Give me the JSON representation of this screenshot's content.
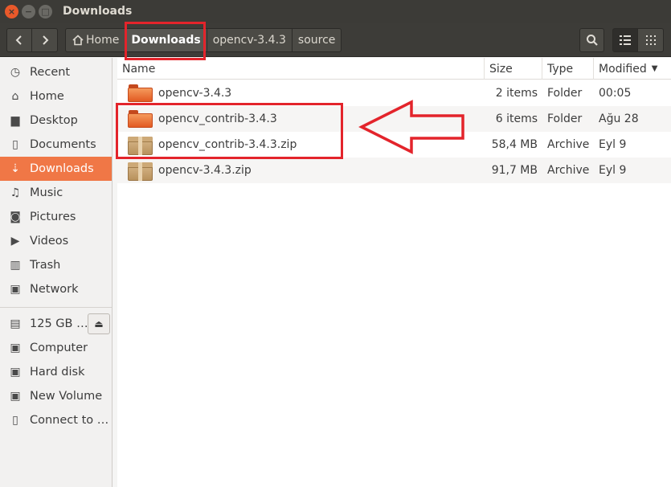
{
  "window": {
    "title": "Downloads",
    "close_glyph": "×",
    "min_glyph": "−",
    "max_glyph": "□"
  },
  "toolbar": {
    "back_glyph": "‹",
    "forward_glyph": "›",
    "breadcrumbs": [
      {
        "label": "Home",
        "icon": "home-icon"
      },
      {
        "label": "Downloads",
        "active": true
      },
      {
        "label": "opencv-3.4.3"
      },
      {
        "label": "source"
      }
    ]
  },
  "sidebar": {
    "places": [
      {
        "label": "Recent",
        "icon": "clock-icon",
        "glyph": "◷"
      },
      {
        "label": "Home",
        "icon": "home-icon",
        "glyph": "⌂"
      },
      {
        "label": "Desktop",
        "icon": "desktop-folder-icon",
        "glyph": "▆"
      },
      {
        "label": "Documents",
        "icon": "document-icon",
        "glyph": "▯"
      },
      {
        "label": "Downloads",
        "icon": "download-icon",
        "glyph": "⇣",
        "selected": true
      },
      {
        "label": "Music",
        "icon": "music-icon",
        "glyph": "♫"
      },
      {
        "label": "Pictures",
        "icon": "camera-icon",
        "glyph": "◙"
      },
      {
        "label": "Videos",
        "icon": "video-icon",
        "glyph": "▶"
      },
      {
        "label": "Trash",
        "icon": "trash-icon",
        "glyph": "▥"
      },
      {
        "label": "Network",
        "icon": "network-icon",
        "glyph": "▣"
      }
    ],
    "devices": [
      {
        "label": "125 GB …",
        "icon": "drive-icon",
        "glyph": "▤",
        "eject_glyph": "⏏"
      },
      {
        "label": "Computer",
        "icon": "computer-drive-icon",
        "glyph": "▣"
      },
      {
        "label": "Hard disk",
        "icon": "harddisk-icon",
        "glyph": "▣"
      },
      {
        "label": "New Volume",
        "icon": "volume-icon",
        "glyph": "▣"
      },
      {
        "label": "Connect to S…",
        "icon": "server-icon",
        "glyph": "▯"
      }
    ]
  },
  "columns": {
    "name": "Name",
    "size": "Size",
    "type": "Type",
    "modified": "Modified",
    "sort_glyph": "▼"
  },
  "files": [
    {
      "name": "opencv-3.4.3",
      "size": "2 items",
      "type": "Folder",
      "modified": "00:05",
      "kind": "folder"
    },
    {
      "name": "opencv_contrib-3.4.3",
      "size": "6 items",
      "type": "Folder",
      "modified": "Ağu 28",
      "kind": "folder"
    },
    {
      "name": "opencv_contrib-3.4.3.zip",
      "size": "58,4 MB",
      "type": "Archive",
      "modified": "Eyl 9",
      "kind": "archive"
    },
    {
      "name": "opencv-3.4.3.zip",
      "size": "91,7 MB",
      "type": "Archive",
      "modified": "Eyl 9",
      "kind": "archive"
    }
  ],
  "annotation_color": "#e3242b"
}
